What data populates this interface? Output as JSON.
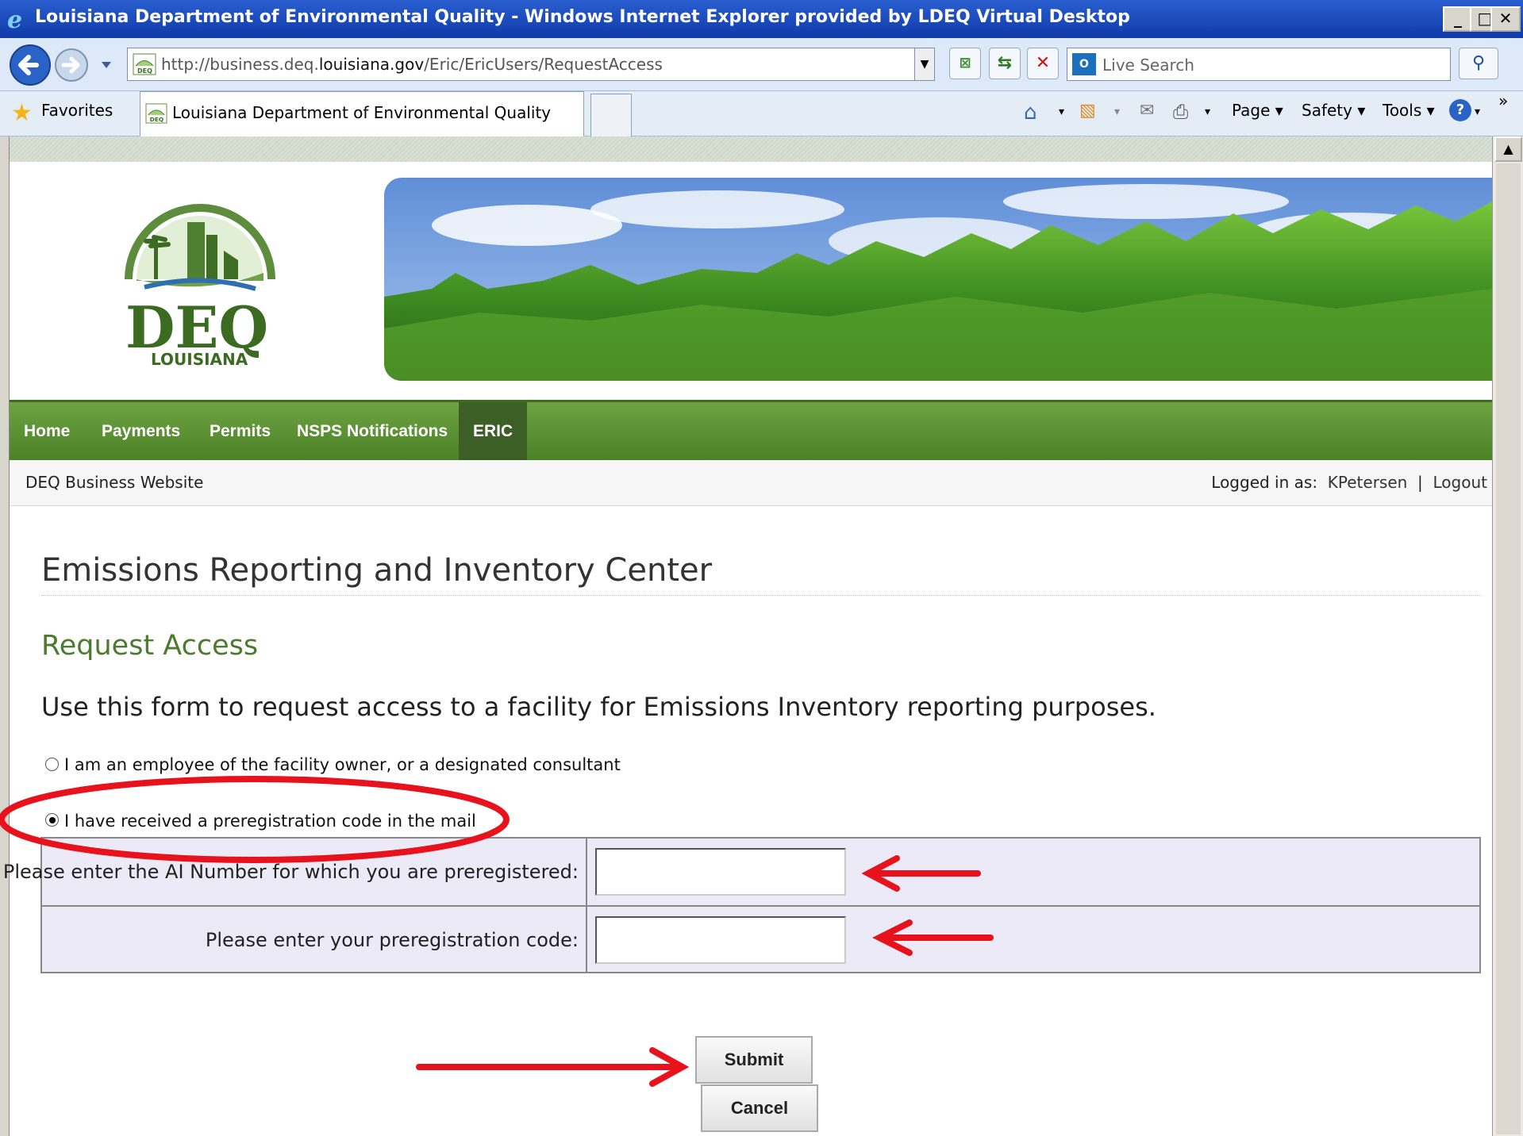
{
  "browser": {
    "window_title": "Louisiana Department of Environmental Quality - Windows Internet Explorer provided by LDEQ Virtual Desktop",
    "url_prefix": "http://business.deq.",
    "url_domain": "louisiana.gov",
    "url_path": "/Eric/EricUsers/RequestAccess",
    "search_placeholder": "Live Search",
    "favorites_label": "Favorites",
    "tab_title": "Louisiana Department of Environmental Quality",
    "commands": {
      "page": "Page",
      "safety": "Safety",
      "tools": "Tools"
    }
  },
  "site": {
    "logo_text": "DEQ",
    "logo_subtext": "LOUISIANA",
    "nav": [
      "Home",
      "Payments",
      "Permits",
      "NSPS Notifications",
      "ERIC"
    ],
    "active_nav": "ERIC",
    "site_name": "DEQ Business Website",
    "logged_in_label": "Logged in as:",
    "username": "KPetersen",
    "separator": "|",
    "logout": "Logout"
  },
  "main": {
    "title": "Emissions Reporting and Inventory Center",
    "subtitle": "Request Access",
    "intro": "Use this form to request access to a facility for Emissions Inventory reporting purposes.",
    "options": [
      {
        "label": "I am an employee of the facility owner, or a designated consultant",
        "selected": false
      },
      {
        "label": "I have received a preregistration code in the mail",
        "selected": true
      }
    ],
    "form": {
      "ai_number_label": "Please enter the AI Number for which you are preregistered:",
      "ai_number_value": "",
      "code_label": "Please enter your preregistration code:",
      "code_value": ""
    },
    "submit_label": "Submit",
    "cancel_label": "Cancel"
  },
  "annotation_color": "#e8121c"
}
